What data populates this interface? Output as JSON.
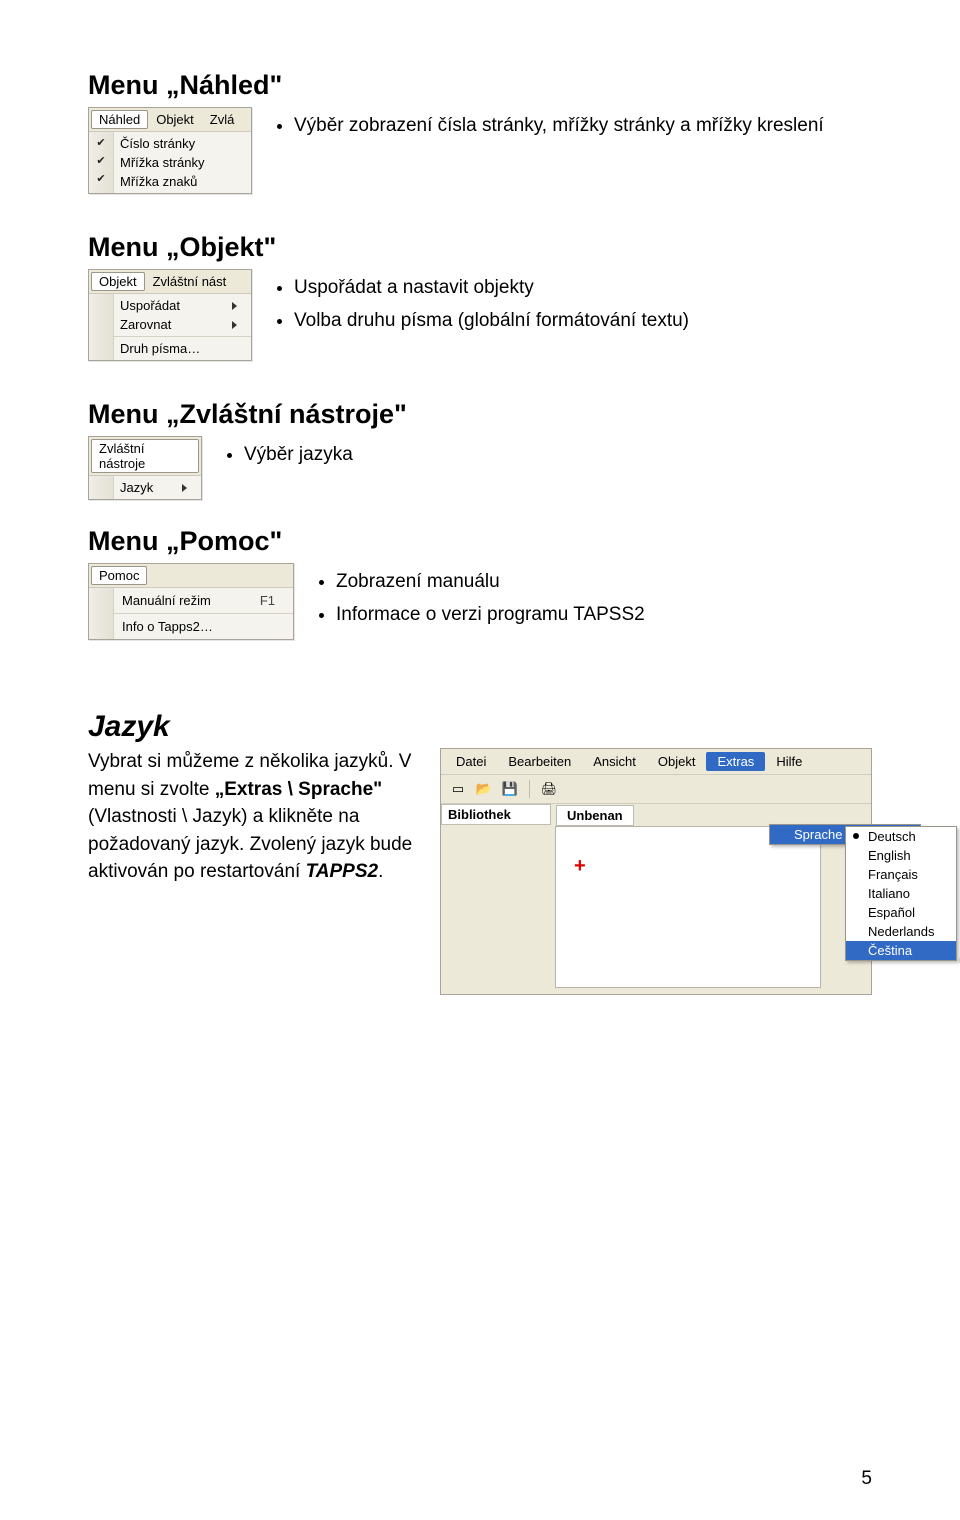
{
  "page_number": "5",
  "sections": {
    "nahled": {
      "title": "Menu „Náhled\"",
      "bullets": [
        "Výběr zobrazení čísla stránky, mřížky stránky a mřížky kreslení"
      ],
      "bar": [
        "Náhled",
        "Objekt",
        "Zvlá"
      ],
      "items": [
        "Číslo stránky",
        "Mřížka stránky",
        "Mřížka znaků"
      ]
    },
    "objekt": {
      "title": "Menu „Objekt\"",
      "bullets": [
        "Uspořádat a nastavit objekty",
        "Volba druhu písma (globální formátování textu)"
      ],
      "bar": [
        "Objekt",
        "Zvláštní nást"
      ],
      "items": [
        "Uspořádat",
        "Zarovnat"
      ],
      "last_item": "Druh písma…"
    },
    "zvlastni": {
      "title": "Menu „Zvláštní nástroje\"",
      "bullets": [
        "Výběr jazyka"
      ],
      "bar": [
        "Zvláštní nástroje"
      ],
      "items": [
        "Jazyk"
      ]
    },
    "pomoc": {
      "title": "Menu „Pomoc\"",
      "bullets": [
        "Zobrazení manuálu",
        "Informace o verzi programu TAPSS2"
      ],
      "bar": [
        "Pomoc"
      ],
      "items": [
        {
          "label": "Manuální režim",
          "shortcut": "F1"
        },
        {
          "label": "Info o Tapps2…",
          "shortcut": ""
        }
      ]
    }
  },
  "jazyk": {
    "title": "Jazyk",
    "p1": " Vybrat si můžeme z několika jazyků. V menu si zvolte ",
    "p_strong": "„Extras \\ Sprache\"",
    "p2": " (Vlastnosti \\ Jazyk) a klikněte na požadovaný jazyk. Zvolený jazyk bude aktivován po restartování ",
    "p_em": "TAPPS2",
    "p3": "."
  },
  "app": {
    "menubar": [
      "Datei",
      "Bearbeiten",
      "Ansicht",
      "Objekt",
      "Extras",
      "Hilfe"
    ],
    "side_tab": "Bibliothek",
    "canvas_tab": "Unbenan",
    "extras_menu_item": "Sprache",
    "languages": [
      "Deutsch",
      "English",
      "Français",
      "Italiano",
      "Español",
      "Nederlands",
      "Čeština"
    ],
    "selected_language": "Čeština",
    "current_language": "Deutsch"
  }
}
